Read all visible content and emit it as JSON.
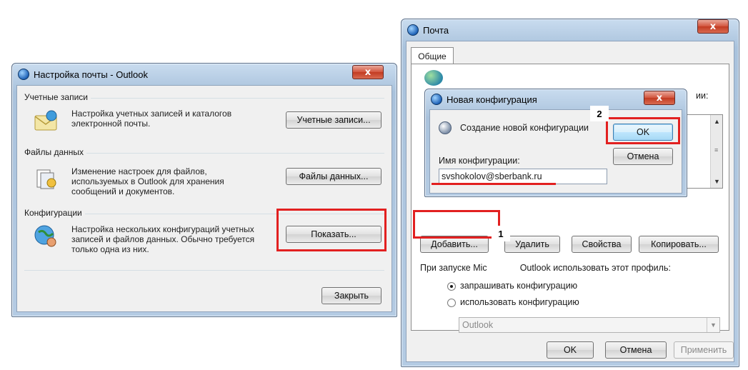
{
  "left_window": {
    "title": "Настройка почты - Outlook",
    "close_glyph": "x",
    "sections": {
      "accounts": {
        "label": "Учетные записи",
        "description": [
          "Настройка учетных записей и каталогов",
          "электронной почты."
        ],
        "button": "Учетные записи..."
      },
      "data_files": {
        "label": "Файлы данных",
        "description": [
          "Изменение настроек для файлов,",
          "используемых в Outlook для хранения",
          "сообщений и документов."
        ],
        "button": "Файлы данных..."
      },
      "profiles": {
        "label": "Конфигурации",
        "description": [
          "Настройка нескольких конфигураций учетных",
          "записей и файлов данных. Обычно требуется",
          "только одна из них."
        ],
        "button": "Показать..."
      }
    },
    "close_button": "Закрыть"
  },
  "right_window": {
    "title": "Почта",
    "close_glyph": "x",
    "tab": "Общие",
    "partial_text": "ии:",
    "buttons": {
      "add": "Добавить...",
      "remove": "Удалить",
      "properties": "Свойства",
      "copy": "Копировать..."
    },
    "startup_label": "При запуске Microsoft Outlook использовать этот профиль:",
    "startup_label_visible": "При запуске Mic",
    "startup_label_rest": "Outlook использовать этот профиль:",
    "radio_prompt": "запрашивать конфигурацию",
    "radio_use": "использовать конфигурацию",
    "profile_select": "Outlook",
    "footer": {
      "ok": "OK",
      "cancel": "Отмена",
      "apply": "Применить"
    }
  },
  "new_profile_dialog": {
    "title": "Новая конфигурация",
    "close_glyph": "x",
    "heading": "Создание новой конфигурации",
    "name_label": "Имя конфигурации:",
    "name_value": "svshokolov@sberbank.ru",
    "ok": "OK",
    "cancel": "Отмена"
  },
  "annotations": {
    "step1": "1",
    "step2": "2",
    "highlight_color": "#e22020"
  }
}
